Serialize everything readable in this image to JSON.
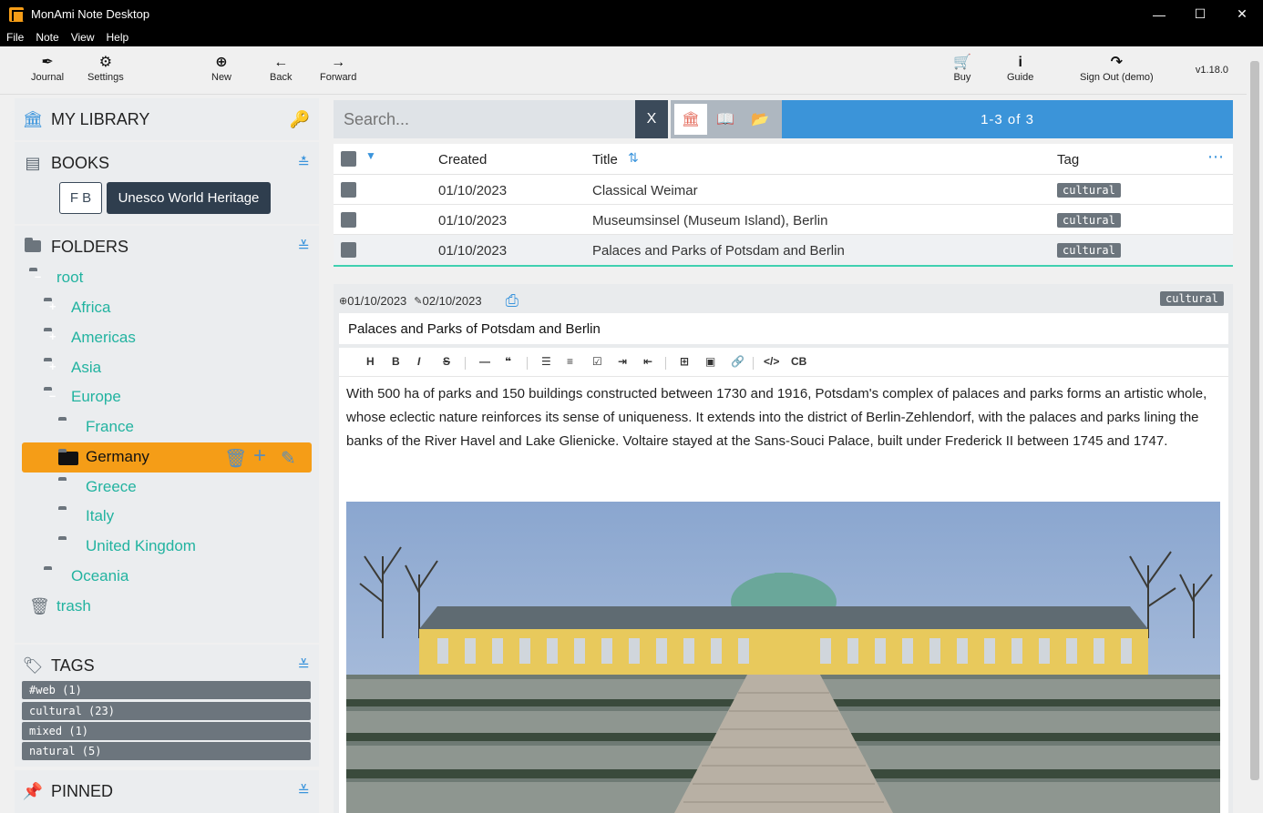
{
  "window": {
    "title": "MonAmi Note Desktop"
  },
  "menu": [
    "File",
    "Note",
    "View",
    "Help"
  ],
  "toolbar": {
    "journal": "Journal",
    "settings": "Settings",
    "new": "New",
    "back": "Back",
    "forward": "Forward",
    "buy": "Buy",
    "guide": "Guide",
    "signout": "Sign Out (demo)",
    "version": "v1.18.0"
  },
  "sidebar": {
    "library": "MY LIBRARY",
    "books": {
      "title": "BOOKS",
      "fb": "F B",
      "active_book": "Unesco World Heritage"
    },
    "folders": {
      "title": "FOLDERS",
      "root": "root",
      "africa": "Africa",
      "americas": "Americas",
      "asia": "Asia",
      "europe": "Europe",
      "france": "France",
      "germany": "Germany",
      "greece": "Greece",
      "italy": "Italy",
      "uk": "United Kingdom",
      "oceania": "Oceania",
      "trash": "trash"
    },
    "tags": {
      "title": "TAGS",
      "items": [
        "#web (1)",
        "cultural (23)",
        "mixed (1)",
        "natural (5)"
      ]
    },
    "pinned": {
      "title": "PINNED"
    }
  },
  "search": {
    "placeholder": "Search...",
    "clear": "X",
    "results": "1-3 of 3"
  },
  "list": {
    "headers": {
      "created": "Created",
      "title": "Title",
      "tag": "Tag"
    },
    "rows": [
      {
        "created": "01/10/2023",
        "title": "Classical Weimar",
        "tag": "cultural"
      },
      {
        "created": "01/10/2023",
        "title": "Museumsinsel (Museum Island), Berlin",
        "tag": "cultural"
      },
      {
        "created": "01/10/2023",
        "title": "Palaces and Parks of Potsdam and Berlin",
        "tag": "cultural"
      }
    ]
  },
  "note": {
    "created": "01/10/2023",
    "modified": "02/10/2023",
    "tag": "cultural",
    "title": "Palaces and Parks of Potsdam and Berlin",
    "body": "With 500 ha of parks and 150 buildings constructed between 1730 and 1916, Potsdam's complex of palaces and parks forms an artistic whole, whose eclectic nature reinforces its sense of uniqueness. It extends into the district of Berlin-Zehlendorf, with the palaces and parks lining the banks of the River Havel and Lake Glienicke. Voltaire stayed at the Sans-Souci Palace, built under Frederick II between 1745 and 1747."
  },
  "format_tools": [
    "H",
    "B",
    "I",
    "S",
    "—",
    "❝",
    "☰",
    "≡",
    "☑",
    "⇥",
    "⇤",
    "⊞",
    "▣",
    "🔗",
    "</>",
    "CB"
  ],
  "colors": {
    "accent": "#f59d17",
    "teal": "#22b3a0",
    "blue": "#3b94d9",
    "gray": "#6c757d"
  }
}
